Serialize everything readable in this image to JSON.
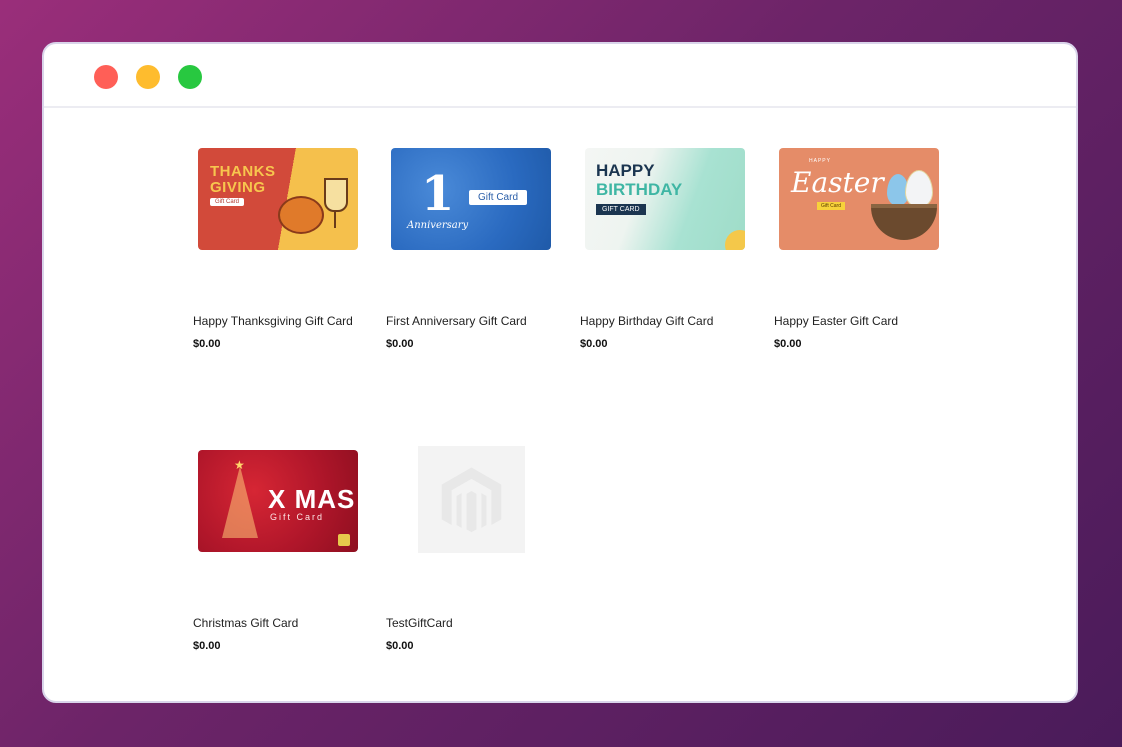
{
  "window": {
    "traffic_lights": [
      "close",
      "minimize",
      "maximize"
    ],
    "colors": {
      "close": "#ff5f57",
      "minimize": "#febc2e",
      "maximize": "#28c840"
    }
  },
  "products": [
    {
      "name": "Happy Thanksgiving Gift Card",
      "price": "$0.00",
      "image_text": {
        "title": "THANKS GIVING",
        "tag": "Gift Card"
      }
    },
    {
      "name": "First Anniversary Gift Card",
      "price": "$0.00",
      "image_text": {
        "number": "1",
        "sub": "Anniversary",
        "tag": "Gift Card"
      }
    },
    {
      "name": "Happy Birthday Gift Card",
      "price": "$0.00",
      "image_text": {
        "line1": "HAPPY",
        "line2": "BIRTHDAY",
        "tag": "GIFT CARD"
      }
    },
    {
      "name": "Happy Easter Gift Card",
      "price": "$0.00",
      "image_text": {
        "small": "HAPPY",
        "title": "Easter",
        "tag": "Gift Card"
      }
    },
    {
      "name": "Christmas Gift Card",
      "price": "$0.00",
      "image_text": {
        "title": "X MAS",
        "tag": "Gift Card"
      }
    },
    {
      "name": "TestGiftCard",
      "price": "$0.00",
      "image_icon": "magento-logo-placeholder-icon"
    }
  ]
}
